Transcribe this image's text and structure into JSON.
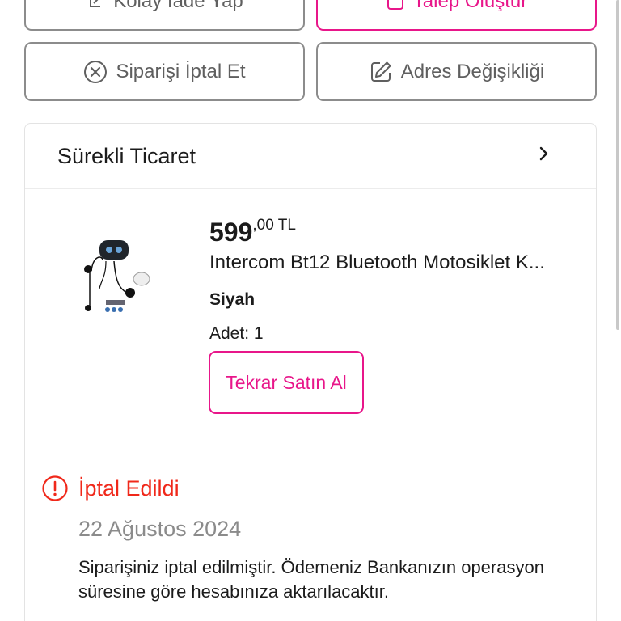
{
  "actions": {
    "easy_return_label": "Kolay İade Yap",
    "create_request_label": "Talep Oluştur",
    "cancel_order_label": "Siparişi İptal Et",
    "address_change_label": "Adres Değişikliği"
  },
  "seller": {
    "name": "Sürekli Ticaret"
  },
  "product": {
    "price_integer": "599",
    "price_decimal": ",00 TL",
    "title": "Intercom Bt12 Bluetooth Motosiklet K...",
    "variant": "Siyah",
    "quantity": "Adet: 1",
    "rebuy_label": "Tekrar Satın Al"
  },
  "status": {
    "title": "İptal Edildi",
    "date": "22 Ağustos 2024",
    "message": "Siparişiniz iptal edilmiştir. Ödemeniz Bankanızın operasyon süresine göre hesabınıza aktarılacaktır."
  },
  "colors": {
    "accent": "#e8168a",
    "cancelled": "#f0281a",
    "muted": "#8b8b8b"
  },
  "icons": {
    "easy_return": "return-arrow-icon",
    "create_request": "request-icon",
    "cancel_order": "circle-x-icon",
    "address_change": "edit-icon",
    "seller_chevron": "chevron-right-icon",
    "status": "alert-circle-icon"
  }
}
